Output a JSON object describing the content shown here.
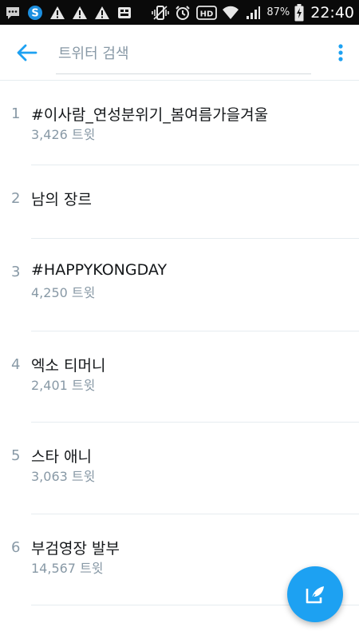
{
  "status_bar": {
    "icons": [
      "message-icon",
      "skype-icon",
      "warning-icon",
      "warning-icon",
      "warning-icon",
      "app-icon",
      "vibrate-icon",
      "alarm-icon",
      "hd-icon",
      "wifi-icon",
      "signal-icon"
    ],
    "hd_label": "HD",
    "battery_percent": "87%",
    "time": "22:40"
  },
  "app_bar": {
    "search_placeholder": "트위터 검색"
  },
  "trends": [
    {
      "rank": "1",
      "name": "#이사람_연성분위기_봄여름가을겨울",
      "count": "3,426 트윗"
    },
    {
      "rank": "2",
      "name": "남의 장르",
      "count": ""
    },
    {
      "rank": "3",
      "name": "#HAPPYKONGDAY",
      "count": "4,250 트윗"
    },
    {
      "rank": "4",
      "name": "엑소 티머니",
      "count": "2,401 트윗"
    },
    {
      "rank": "5",
      "name": "스타 애니",
      "count": "3,063 트윗"
    },
    {
      "rank": "6",
      "name": "부검영장 발부",
      "count": "14,567 트윗"
    }
  ],
  "colors": {
    "accent": "#1da1f2",
    "muted_text": "#8899a6",
    "divider": "#e6ecf0"
  }
}
